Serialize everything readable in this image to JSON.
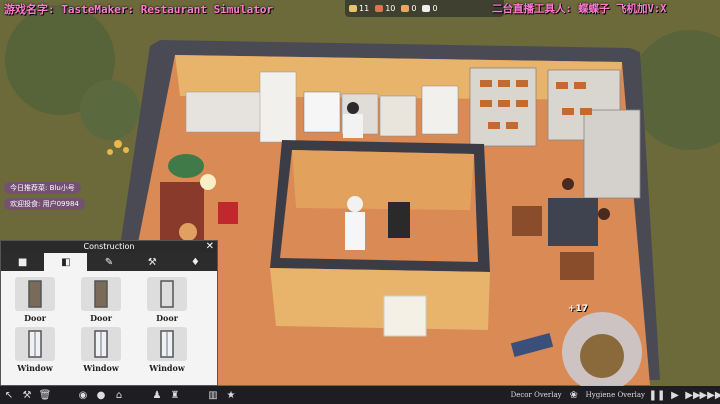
{
  "stream": {
    "title": "游戏名字: TasteMaker: Restaurant Simulator",
    "right_text": "二台直播工具人: 蝶蝶子 飞机加V:X"
  },
  "resources": [
    {
      "icon": "customers-icon",
      "value": "11",
      "color": "#e9c46a"
    },
    {
      "icon": "stock-icon",
      "value": "10",
      "color": "#e76f51"
    },
    {
      "icon": "food-icon",
      "value": "0",
      "color": "#f4a261"
    },
    {
      "icon": "coin-icon",
      "value": "0",
      "color": "#eeeeee"
    }
  ],
  "info_tags": {
    "today_recommend": "今日推荐菜: Blu小号",
    "welcome_user": "欢迎投食: 用户09984"
  },
  "construction": {
    "title": "Construction",
    "close": "✕",
    "tabs": [
      {
        "name": "tab-floor",
        "icon": "floor-icon",
        "glyph": "■"
      },
      {
        "name": "tab-walls",
        "icon": "wall-icon",
        "glyph": "◧"
      },
      {
        "name": "tab-paint",
        "icon": "brush-icon",
        "glyph": "✎"
      },
      {
        "name": "tab-tools",
        "icon": "tools-icon",
        "glyph": "⚒"
      },
      {
        "name": "tab-lights",
        "icon": "lamp-icon",
        "glyph": "♦"
      }
    ],
    "items": [
      {
        "label": "Door",
        "type": "door"
      },
      {
        "label": "Door",
        "type": "door"
      },
      {
        "label": "Door",
        "type": "door-frame"
      },
      {
        "label": "Window",
        "type": "window"
      },
      {
        "label": "Window",
        "type": "window-arch"
      },
      {
        "label": "Window",
        "type": "window-tall"
      }
    ]
  },
  "bottom": {
    "decor_overlay": "Decor Overlay",
    "hygiene_overlay": "Hygiene Overlay"
  },
  "floating": {
    "score": "+17"
  }
}
